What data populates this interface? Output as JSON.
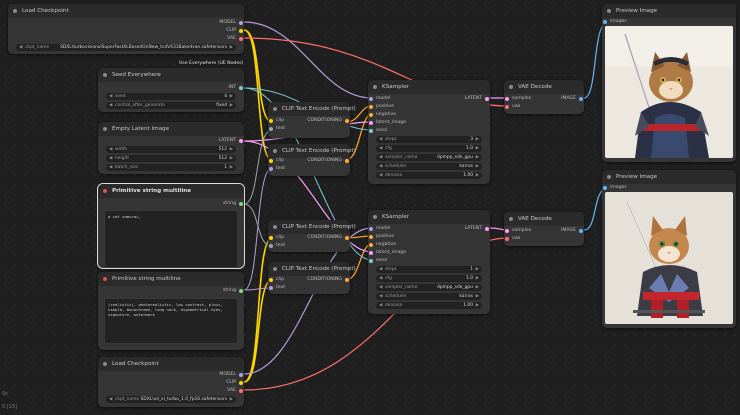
{
  "colors": {
    "model": "#b39ddb",
    "clip": "#ffd500",
    "vae": "#ff6e6e",
    "conditioning": "#ffa931",
    "latent": "#ff9cf9",
    "image": "#64b5f6",
    "string": "#7cdc76",
    "int": "#7fc9d6"
  },
  "nodes": {
    "load_ckpt_1": {
      "title": "Load Checkpoint",
      "out_model": "MODEL",
      "out_clip": "CLIP",
      "out_vae": "VAE",
      "ckpt_label": "ckpt_name",
      "ckpt_value": "SDXL\\turbovisionxlSuperFastXLBasedOnNew_tcdV431Bakedvae.safetensors"
    },
    "ue_badge": "Use Everywhere (UE Nodes)",
    "seed": {
      "title": "Seed Everywhere",
      "out_int": "INT",
      "seed_label": "seed",
      "seed_value": "4",
      "cag_label": "control_after_generate",
      "cag_value": "fixed"
    },
    "latent": {
      "title": "Empty Latent Image",
      "out": "LATENT",
      "width_label": "width",
      "width_value": "512",
      "height_label": "height",
      "height_value": "512",
      "batch_label": "batch_size",
      "batch_value": "1"
    },
    "prim1": {
      "title": "Primitive string multiline",
      "out": "string",
      "text": "a cat samurai,"
    },
    "prim2": {
      "title": "Primitive string multiline",
      "out": "string",
      "text": "(realistic), photorealistic, low contrast, plain, simple, monochrome, long neck, asymmetrical eyes, signature, watermark"
    },
    "load_ckpt_2": {
      "title": "Load Checkpoint",
      "out_model": "MODEL",
      "out_clip": "CLIP",
      "out_vae": "VAE",
      "ckpt_label": "ckpt_name",
      "ckpt_value": "SDXL\\sd_xl_turbo_1.0_fp16.safetensors"
    },
    "clip1": {
      "title": "CLIP Text Encode (Prompt)",
      "in_clip": "clip",
      "in_text": "text",
      "out": "CONDITIONING"
    },
    "clip2": {
      "title": "CLIP Text Encode (Prompt)",
      "in_clip": "clip",
      "in_text": "text",
      "out": "CONDITIONING"
    },
    "clip3": {
      "title": "CLIP Text Encode (Prompt)",
      "in_clip": "clip",
      "in_text": "text",
      "out": "CONDITIONING"
    },
    "clip4": {
      "title": "CLIP Text Encode (Prompt)",
      "in_clip": "clip",
      "in_text": "text",
      "out": "CONDITIONING"
    },
    "ks1": {
      "title": "KSampler",
      "in_model": "model",
      "in_pos": "positive",
      "in_neg": "negative",
      "in_latent": "latent_image",
      "in_seed": "seed",
      "out": "LATENT",
      "w": [
        [
          "steps",
          "3"
        ],
        [
          "cfg",
          "1.0"
        ],
        [
          "sampler_name",
          "dpmpp_sde_gpu"
        ],
        [
          "scheduler",
          "karras"
        ],
        [
          "denoise",
          "1.00"
        ]
      ]
    },
    "ks2": {
      "title": "KSampler",
      "in_model": "model",
      "in_pos": "positive",
      "in_neg": "negative",
      "in_latent": "latent_image",
      "in_seed": "seed",
      "out": "LATENT",
      "w": [
        [
          "steps",
          "1"
        ],
        [
          "cfg",
          "1.0"
        ],
        [
          "sampler_name",
          "dpmpp_sde_gpu"
        ],
        [
          "scheduler",
          "karras"
        ],
        [
          "denoise",
          "1.00"
        ]
      ]
    },
    "vae1": {
      "title": "VAE Decode",
      "in_samples": "samples",
      "in_vae": "vae",
      "out": "IMAGE"
    },
    "vae2": {
      "title": "VAE Decode",
      "in_samples": "samples",
      "in_vae": "vae",
      "out": "IMAGE"
    },
    "prev1": {
      "title": "Preview Image",
      "in": "images"
    },
    "prev2": {
      "title": "Preview Image",
      "in": "images"
    }
  },
  "status": {
    "line1": "0s",
    "line2": "0 [15]"
  }
}
